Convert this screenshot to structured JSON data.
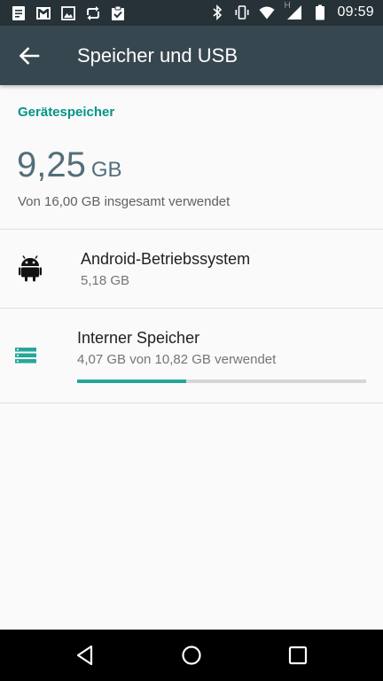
{
  "status_bar": {
    "time": "09:59",
    "notification_icons": [
      "document-icon",
      "gmail-icon",
      "image-icon",
      "sync-icon",
      "clipboard-check-icon"
    ],
    "system_icons": [
      "bluetooth-icon",
      "vibrate-icon",
      "wifi-icon",
      "signal-icon",
      "battery-icon"
    ],
    "network_type": "H"
  },
  "app_bar": {
    "title": "Speicher und USB",
    "back_icon": "arrow-back-icon"
  },
  "device_storage": {
    "header": "Gerätespeicher",
    "used_value": "9,25",
    "used_unit": "GB",
    "total_text": "Von 16,00 GB insgesamt verwendet"
  },
  "items": [
    {
      "title": "Android-Betriebssystem",
      "subtitle": "5,18 GB",
      "icon": "android-icon"
    },
    {
      "title": "Interner Speicher",
      "subtitle": "4,07 GB von 10,82 GB verwendet",
      "icon": "storage-icon",
      "progress_fraction": 0.376
    }
  ],
  "nav_bar": {
    "buttons": [
      "back-triangle-icon",
      "home-circle-icon",
      "recents-square-icon"
    ]
  },
  "colors": {
    "status_bar": "#263238",
    "app_bar": "#37474f",
    "accent": "#009688",
    "progress": "#26a69a"
  }
}
